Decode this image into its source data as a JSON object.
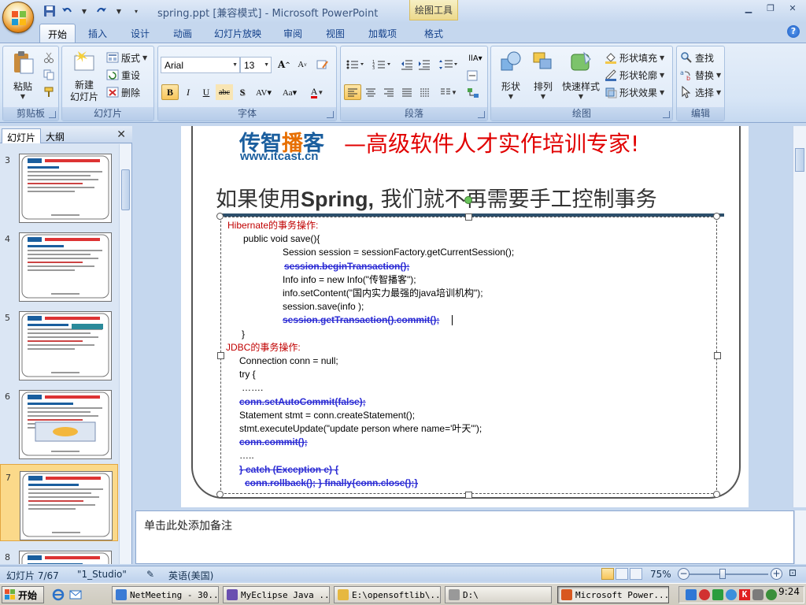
{
  "window": {
    "title": "spring.ppt [兼容模式] - Microsoft PowerPoint",
    "context_tab_group": "绘图工具"
  },
  "ribbon_tabs": [
    "开始",
    "插入",
    "设计",
    "动画",
    "幻灯片放映",
    "审阅",
    "视图",
    "加载项",
    "格式"
  ],
  "ribbon": {
    "clipboard": {
      "label": "剪贴板",
      "paste": "粘贴"
    },
    "slides": {
      "label": "幻灯片",
      "new_slide": "新建\n幻灯片",
      "layout": "版式",
      "reset": "重设",
      "delete": "删除"
    },
    "font": {
      "label": "字体",
      "font_name": "Arial",
      "font_size": "13"
    },
    "paragraph": {
      "label": "段落"
    },
    "drawing": {
      "label": "绘图",
      "shapes": "形状",
      "arrange": "排列",
      "quick_styles": "快速样式",
      "shape_fill": "形状填充",
      "shape_outline": "形状轮廓",
      "shape_effects": "形状效果"
    },
    "editing": {
      "label": "编辑",
      "find": "查找",
      "replace": "替换",
      "select": "选择"
    }
  },
  "left_pane": {
    "tab_slides": "幻灯片",
    "tab_outline": "大纲",
    "thumbnails": [
      {
        "number": "3",
        "selected": false
      },
      {
        "number": "4",
        "selected": false
      },
      {
        "number": "5",
        "selected": false
      },
      {
        "number": "6",
        "selected": false
      },
      {
        "number": "7",
        "selected": true
      },
      {
        "number": "8",
        "selected": false
      }
    ]
  },
  "slide": {
    "brand_cn_1": "传智",
    "brand_cn_2": "播",
    "brand_cn_3": "客",
    "brand_url": "www.itcast.cn",
    "slogan": "—高级软件人才实作培训专家!",
    "title_prefix": "如果使用",
    "title_bold": "Spring,",
    "title_suffix": " 我们就不再需要手工控制事务",
    "code_lines": [
      "Hibernate的事务操作:",
      "public void save(){",
      "Session session = sessionFactory.getCurrentSession();",
      "session.beginTransaction();",
      "Info info = new Info(\"传智播客\");",
      "info.setContent(\"国内实力最强的java培训机构\");",
      "session.save(info );",
      "session.getTransaction().commit();",
      "}",
      "JDBC的事务操作:",
      "Connection conn = null;",
      "try {",
      "…….",
      "conn.setAutoCommit(false);",
      "Statement stmt = conn.createStatement();",
      "stmt.executeUpdate(\"update person where name='叶天'\");",
      "conn.commit();",
      "…..",
      "} catch (Exception e) {",
      "conn.rollback();   } finally{conn.close();}"
    ]
  },
  "notes": {
    "placeholder": "单击此处添加备注"
  },
  "status": {
    "slide_counter": "幻灯片 7/67",
    "theme": "\"1_Studio\"",
    "language": "英语(美国)",
    "zoom": "75%",
    "zoom_fraction": 0.42
  },
  "taskbar": {
    "start": "开始",
    "tasks": [
      "NetMeeting - 30...",
      "MyEclipse Java ...",
      "E:\\opensoftlib\\...",
      "D:\\",
      "Microsoft Power..."
    ],
    "clock": "9:24"
  }
}
